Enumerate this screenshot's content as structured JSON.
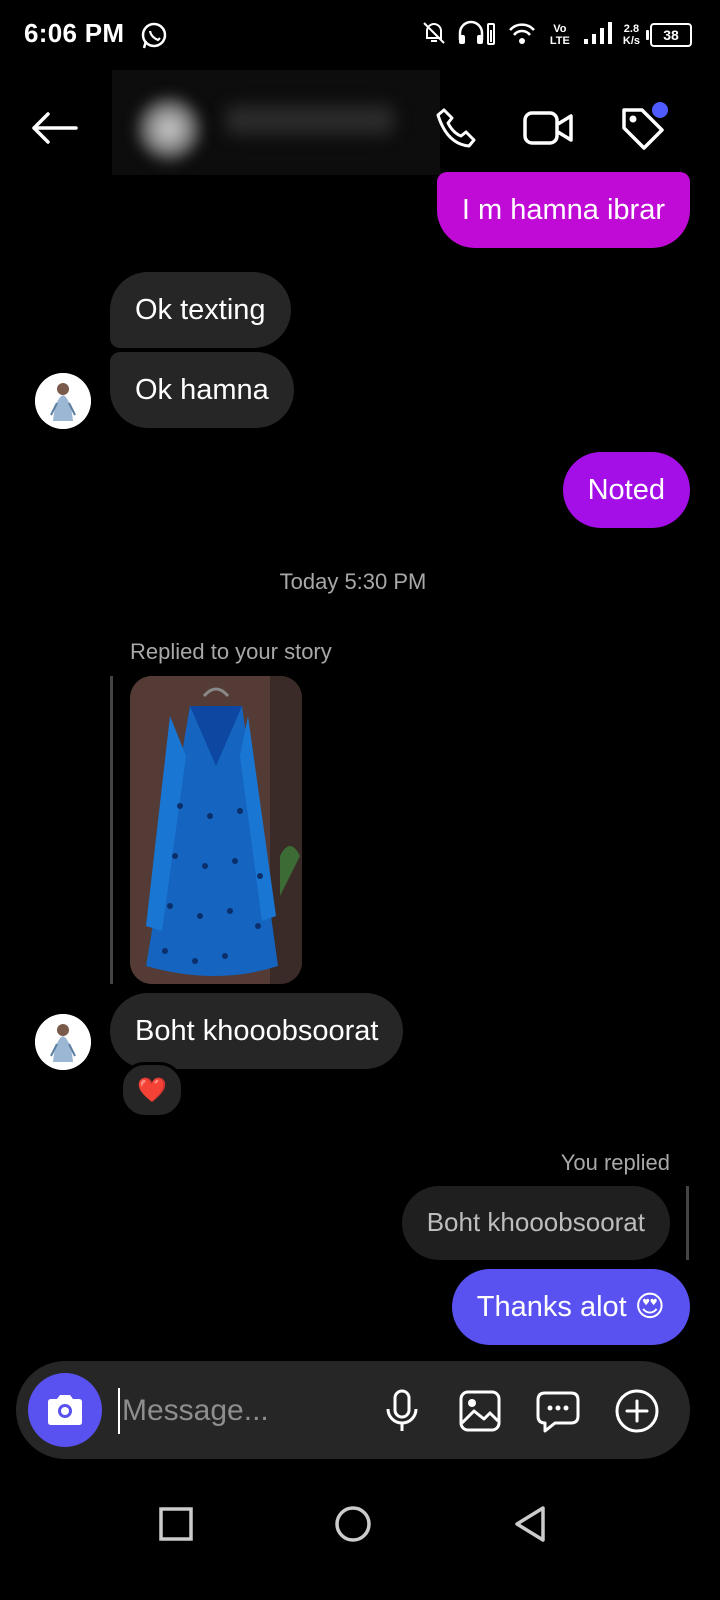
{
  "status_bar": {
    "time": "6:06 PM",
    "network_type": "Vo LTE",
    "speed_value": "2.8",
    "speed_unit": "K/s",
    "battery": "38"
  },
  "header": {
    "contact_name_blurred": true,
    "icons": [
      "back-arrow-icon",
      "phone-icon",
      "video-camera-icon",
      "tag-icon"
    ],
    "tag_dot_color": "#4f5bff"
  },
  "messages": {
    "m1": "I m hamna ibrar",
    "m2": "Ok texting",
    "m3": "Ok hamna",
    "m4": "Noted",
    "timestamp": "Today 5:30 PM",
    "story_reply_label": "Replied to your story",
    "m5": "Boht khooobsoorat",
    "m5_reaction": "❤️",
    "you_replied_label": "You replied",
    "quoted_text": "Boht khooobsoorat",
    "m6": "Thanks alot 😍"
  },
  "composer": {
    "placeholder": "Message..."
  },
  "colors": {
    "outgoing_magenta": "#c00ad6",
    "outgoing_purple": "#a40fe8",
    "outgoing_blue": "#5a52f0",
    "incoming": "#262626"
  }
}
